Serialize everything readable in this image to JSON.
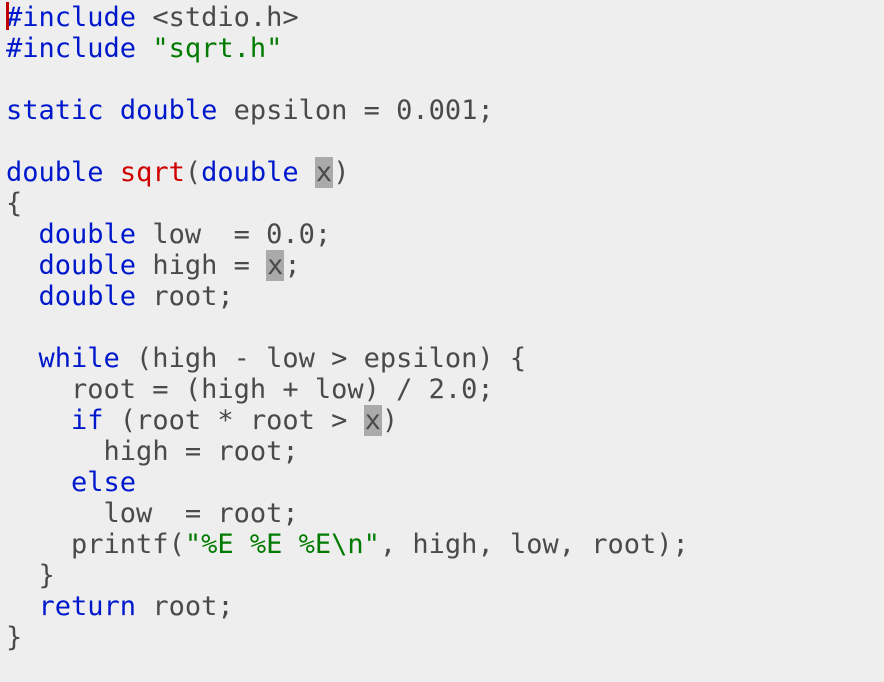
{
  "code": {
    "line1": {
      "k1": "#include ",
      "h1": "<stdio.h>"
    },
    "line2": {
      "k1": "#include ",
      "s1": "\"sqrt.h\""
    },
    "line4": {
      "k1": "static",
      "k2": "double",
      "t1": " epsilon = 0.001;"
    },
    "line6": {
      "k1": "double",
      "fn": "sqrt",
      "t1": "(",
      "k2": "double",
      "t2": " ",
      "bx": "x",
      "t3": ")"
    },
    "line7": {
      "t1": "{"
    },
    "line8": {
      "k1": "double",
      "t1": " low  = 0.0;"
    },
    "line9": {
      "k1": "double",
      "t1": " high = ",
      "bx": "x",
      "t2": ";"
    },
    "line10": {
      "k1": "double",
      "t1": " root;"
    },
    "line12": {
      "k1": "while",
      "t1": " (high - low > epsilon) {"
    },
    "line13": {
      "t1": "root = (high + low) / 2.0;"
    },
    "line14": {
      "k1": "if",
      "t1": " (root * root > ",
      "bx": "x",
      "t2": ")"
    },
    "line15": {
      "t1": "high = root;"
    },
    "line16": {
      "k1": "else"
    },
    "line17": {
      "t1": "low  = root;"
    },
    "line18": {
      "t1": "printf(",
      "s1": "\"%E %E %E\\n\"",
      "t2": ", high, low, root);"
    },
    "line19": {
      "t1": "}"
    },
    "line20": {
      "k1": "return",
      "t1": " root;"
    },
    "line21": {
      "t1": "}"
    }
  }
}
